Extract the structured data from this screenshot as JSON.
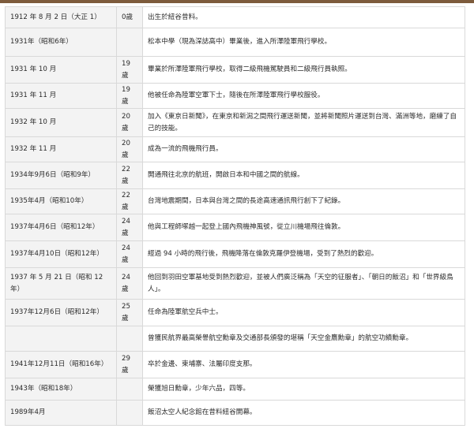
{
  "timeline": {
    "rows": [
      {
        "date": "1912 年 8 月 2 日（大正 1）",
        "age": "0歲",
        "event": "出生於紐谷昔料。",
        "height": 27
      },
      {
        "date": "1931年（昭和6年）",
        "age": "",
        "event": "松本中學（現為深誌高中）畢業後，進入所澤陸軍飛行學校。",
        "height": 36
      },
      {
        "date": "1931 年 10 月",
        "age": "19 歲",
        "event": "畢業於所澤陸軍飛行學校，取得二級飛機駕駛員和二級飛行員執照。",
        "height": 34
      },
      {
        "date": "1931 年 11 月",
        "age": "19 歲",
        "event": "他被任命為陸軍空軍下士，隨後在所澤陸軍飛行學校服役。",
        "height": 32
      },
      {
        "date": "1932 年 10 月",
        "age": "20 歲",
        "event": "加入《東京日新聞》，在東京和新潟之間飛行運送新聞，並將新聞照片運送到台灣、滿洲等地，磨練了自己的技能。",
        "height": 36
      },
      {
        "date": "1932 年 11 月",
        "age": "20 歲",
        "event": "成為一流的飛機飛行員。",
        "height": 32
      },
      {
        "date": "1934年9月6日（昭和9年）",
        "age": "22 歲",
        "event": "開通飛往北京的航班，開啟日本和中國之間的航線。",
        "height": 34
      },
      {
        "date": "1935年4月（昭和10年）",
        "age": "22 歲",
        "event": "台灣地震期間，日本與台灣之間的長途高速通訊飛行創下了紀錄。",
        "height": 32
      },
      {
        "date": "1937年4月6日（昭和12年）",
        "age": "24 歲",
        "event": "他與工程師塚越一起登上國內飛機神風號，從立川機場飛往倫敦。",
        "height": 34
      },
      {
        "date": "1937年4月10日（昭和12年）",
        "age": "24 歲",
        "event": "經過 94 小時的飛行後，飛機降落在倫敦克羅伊登機場，受到了熱烈的歡迎。",
        "height": 34
      },
      {
        "date": "1937 年 5 月 21 日（昭和 12 年）",
        "age": "24 歲",
        "event": "他回到羽田空軍基地受到熱烈歡迎，並被人們廣泛稱為「天空的征服者」、「朝日的飯沼」和「世界級鳥人」。",
        "height": 40
      },
      {
        "date": "1937年12月6日（昭和12年）",
        "age": "25 歲",
        "event": "任命為陸軍航空兵中士。",
        "height": 34
      },
      {
        "date": "",
        "age": "",
        "event": "曾獲民航界最高榮譽航空勳章及交通部長頒發的堪稱「天空金鷹勳章」的航空功績勳章。",
        "height": 32
      },
      {
        "date": "1941年12月11日（昭和16年）",
        "age": "29 歲",
        "event": "卒於金邊、柬埔寨、法屬印度支那。",
        "height": 34
      },
      {
        "date": "1943年（昭和18年）",
        "age": "",
        "event": "榮獲旭日勳章，少年六品，四等。",
        "height": 28
      },
      {
        "date": "1989年4月",
        "age": "",
        "event": "飯沼太空人紀念館在昔料紐谷開幕。",
        "height": 32
      }
    ]
  }
}
